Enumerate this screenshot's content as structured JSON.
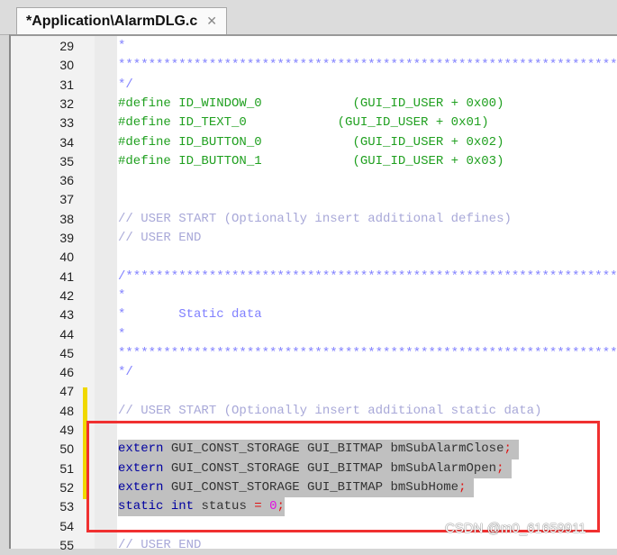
{
  "tab": {
    "title": "*Application\\AlarmDLG.c",
    "close": "✕"
  },
  "lines": [
    {
      "n": "29",
      "segs": [
        [
          "*",
          "c"
        ]
      ]
    },
    {
      "n": "30",
      "segs": [
        [
          "*********************************************************************",
          "c"
        ]
      ]
    },
    {
      "n": "31",
      "segs": [
        [
          "*/",
          "c"
        ]
      ]
    },
    {
      "n": "32",
      "segs": [
        [
          "#define ID_WINDOW_0            ",
          "pp"
        ],
        [
          "(GUI_ID_USER + 0x00)",
          "pp"
        ]
      ]
    },
    {
      "n": "33",
      "segs": [
        [
          "#define ID_TEXT_0            ",
          "pp"
        ],
        [
          "(GUI_ID_USER + 0x01)",
          "pp"
        ]
      ]
    },
    {
      "n": "34",
      "segs": [
        [
          "#define ID_BUTTON_0            ",
          "pp"
        ],
        [
          "(GUI_ID_USER + 0x02)",
          "pp"
        ]
      ]
    },
    {
      "n": "35",
      "segs": [
        [
          "#define ID_BUTTON_1            ",
          "pp"
        ],
        [
          "(GUI_ID_USER + 0x03)",
          "pp"
        ]
      ]
    },
    {
      "n": "36",
      "segs": []
    },
    {
      "n": "37",
      "segs": []
    },
    {
      "n": "38",
      "segs": [
        [
          "// USER START (Optionally insert additional defines)",
          "cm"
        ]
      ]
    },
    {
      "n": "39",
      "segs": [
        [
          "// USER END",
          "cm"
        ]
      ]
    },
    {
      "n": "40",
      "segs": []
    },
    {
      "n": "41",
      "segs": [
        [
          "/********************************************************************",
          "c"
        ]
      ]
    },
    {
      "n": "42",
      "segs": [
        [
          "*",
          "c"
        ]
      ]
    },
    {
      "n": "43",
      "segs": [
        [
          "*       Static data",
          "c"
        ]
      ]
    },
    {
      "n": "44",
      "segs": [
        [
          "*",
          "c"
        ]
      ]
    },
    {
      "n": "45",
      "segs": [
        [
          "*********************************************************************",
          "c"
        ]
      ]
    },
    {
      "n": "46",
      "segs": [
        [
          "*/",
          "c"
        ]
      ]
    },
    {
      "n": "47",
      "segs": []
    },
    {
      "n": "48",
      "segs": [
        [
          "// USER START (Optionally insert additional static data)",
          "cm"
        ]
      ]
    },
    {
      "n": "49",
      "segs": []
    },
    {
      "n": "50",
      "sel": true,
      "segs": [
        [
          "extern",
          "kw"
        ],
        [
          " GUI_CONST_STORAGE GUI_BITMAP bmSubAlarmClose",
          "id"
        ],
        [
          ";",
          "op"
        ],
        [
          " ",
          "id"
        ]
      ]
    },
    {
      "n": "51",
      "sel": true,
      "segs": [
        [
          "extern",
          "kw"
        ],
        [
          " GUI_CONST_STORAGE GUI_BITMAP bmSubAlarmOpen",
          "id"
        ],
        [
          ";",
          "op"
        ],
        [
          " ",
          "id"
        ]
      ]
    },
    {
      "n": "52",
      "sel": true,
      "segs": [
        [
          "extern",
          "kw"
        ],
        [
          " GUI_CONST_STORAGE GUI_BITMAP bmSubHome",
          "id"
        ],
        [
          ";",
          "op"
        ],
        [
          " ",
          "id"
        ]
      ]
    },
    {
      "n": "53",
      "sel": true,
      "segs": [
        [
          "static",
          "kw"
        ],
        [
          " ",
          "id"
        ],
        [
          "int",
          "kw"
        ],
        [
          " status ",
          "id"
        ],
        [
          "=",
          "op"
        ],
        [
          " ",
          "id"
        ],
        [
          "0",
          "num"
        ],
        [
          ";",
          "op"
        ]
      ]
    },
    {
      "n": "54",
      "segs": []
    },
    {
      "n": "55",
      "segs": [
        [
          "// USER END",
          "cm"
        ]
      ]
    }
  ],
  "watermark": "CSDN @m0_61659911"
}
